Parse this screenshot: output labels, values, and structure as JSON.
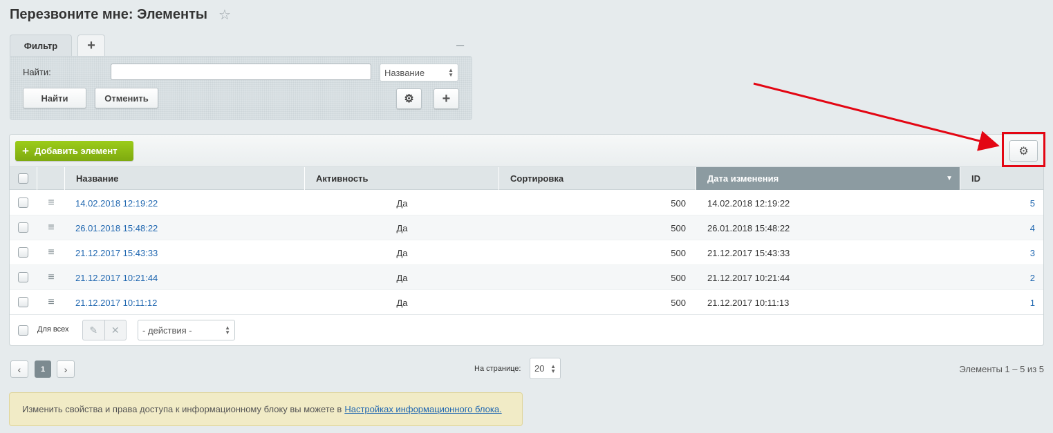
{
  "title": "Перезвоните мне: Элементы",
  "filter": {
    "tab_label": "Фильтр",
    "find_label": "Найти:",
    "find_value": "",
    "field_select": "Название",
    "find_button": "Найти",
    "cancel_button": "Отменить"
  },
  "grid": {
    "add_button": "Добавить элемент",
    "columns": [
      "Название",
      "Активность",
      "Сортировка",
      "Дата изменения",
      "ID"
    ],
    "sorted_column": "Дата изменения",
    "rows": [
      {
        "name": "14.02.2018 12:19:22",
        "active": "Да",
        "sort": "500",
        "modified": "14.02.2018 12:19:22",
        "id": "5"
      },
      {
        "name": "26.01.2018 15:48:22",
        "active": "Да",
        "sort": "500",
        "modified": "26.01.2018 15:48:22",
        "id": "4"
      },
      {
        "name": "21.12.2017 15:43:33",
        "active": "Да",
        "sort": "500",
        "modified": "21.12.2017 15:43:33",
        "id": "3"
      },
      {
        "name": "21.12.2017 10:21:44",
        "active": "Да",
        "sort": "500",
        "modified": "21.12.2017 10:21:44",
        "id": "2"
      },
      {
        "name": "21.12.2017 10:11:12",
        "active": "Да",
        "sort": "500",
        "modified": "21.12.2017 10:11:13",
        "id": "1"
      }
    ],
    "for_all_label": "Для всех",
    "actions_select": "- действия -"
  },
  "pager": {
    "current_page": "1",
    "per_page_label": "На странице:",
    "per_page_value": "20",
    "total": "Элементы 1 – 5 из 5"
  },
  "notice": {
    "text": "Изменить свойства и права доступа к информационному блоку вы можете в",
    "link_text": "Настройках информационного блока."
  },
  "colors": {
    "accent_green": "#8fbf14",
    "link_blue": "#2067b0",
    "highlight_red": "#e30613",
    "sorted_header": "#8c9ba1"
  }
}
